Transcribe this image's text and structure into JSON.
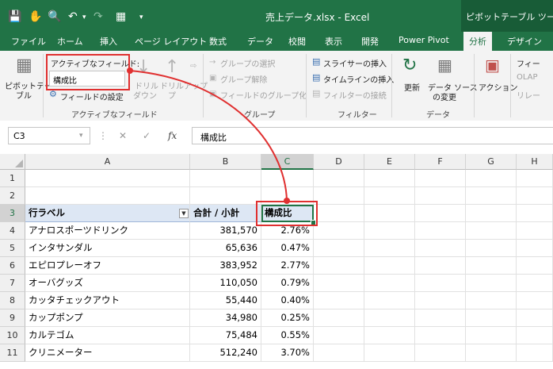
{
  "window": {
    "title": "売上データ.xlsx  -  Excel",
    "context_tab_group": "ピボットテーブル ツール"
  },
  "tabs": [
    "ファイル",
    "ホーム",
    "挿入",
    "ページ レイアウト",
    "数式",
    "データ",
    "校閲",
    "表示",
    "開発",
    "Power Pivot",
    "分析",
    "デザイン"
  ],
  "active_tab": "分析",
  "ribbon": {
    "pivottable_label": "ピボットテー",
    "pivottable_label2": "ブル",
    "active_field_title": "アクティブなフィールド:",
    "active_field_value": "構成比",
    "field_settings": "フィールドの設定",
    "drill_down": "ドリル",
    "drill_down2": "ダウン",
    "drill_up": "ドリルアップ",
    "drill_up2": "プ",
    "group_active_field": "アクティブなフィールド",
    "group_selection": "グループの選択",
    "ungroup": "グループ解除",
    "group_field": "フィールドのグループ化",
    "group_group": "グループ",
    "insert_slicer": "スライサーの挿入",
    "insert_timeline": "タイムラインの挿入",
    "filter_connections": "フィルターの接続",
    "group_filter": "フィルター",
    "refresh": "更新",
    "change_source": "データ ソース",
    "change_source2": "の変更",
    "group_data": "データ",
    "actions": "アクション",
    "fields_list": "フィー",
    "olap": "OLAP",
    "relationships": "リレー"
  },
  "formula_bar": {
    "name_box": "C3",
    "fx": "fx",
    "content": "構成比"
  },
  "columns": [
    "A",
    "B",
    "C",
    "D",
    "E",
    "F",
    "G",
    "H"
  ],
  "rows": [
    {
      "n": "1",
      "a": "",
      "b": "",
      "c": ""
    },
    {
      "n": "2",
      "a": "",
      "b": "",
      "c": ""
    },
    {
      "n": "3",
      "a": "行ラベル",
      "b": "合計 / 小計",
      "c": "構成比"
    },
    {
      "n": "4",
      "a": "アナロスポーツドリンク",
      "b": "381,570",
      "c": "2.76%"
    },
    {
      "n": "5",
      "a": "インタサンダル",
      "b": "65,636",
      "c": "0.47%"
    },
    {
      "n": "6",
      "a": "エピロプレーオフ",
      "b": "383,952",
      "c": "2.77%"
    },
    {
      "n": "7",
      "a": "オーバグッズ",
      "b": "110,050",
      "c": "0.79%"
    },
    {
      "n": "8",
      "a": "カッタチェックアウト",
      "b": "55,440",
      "c": "0.40%"
    },
    {
      "n": "9",
      "a": "カップポンプ",
      "b": "34,980",
      "c": "0.25%"
    },
    {
      "n": "10",
      "a": "カルテゴム",
      "b": "75,484",
      "c": "0.55%"
    },
    {
      "n": "11",
      "a": "クリニメーター",
      "b": "512,240",
      "c": "3.70%"
    }
  ],
  "colors": {
    "excel_green": "#217346",
    "highlight_red": "#e03030",
    "header_fill": "#dde7f4"
  }
}
